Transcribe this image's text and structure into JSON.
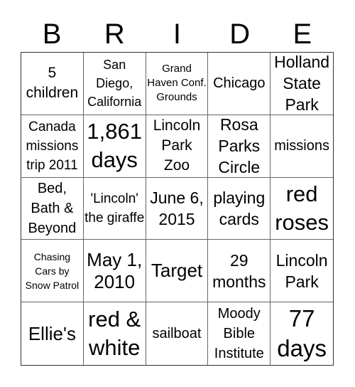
{
  "header": {
    "letters": [
      "B",
      "R",
      "I",
      "D",
      "E"
    ]
  },
  "cells": [
    "5 children",
    "San Diego, California",
    "Grand Haven Conf. Grounds",
    "Chicago",
    "Holland State Park",
    "Canada missions trip 2011",
    "1,861 days",
    "Lincoln Park Zoo",
    "Rosa Parks Circle",
    "missions",
    "Bed, Bath & Beyond",
    "'Lincoln' the giraffe",
    "June 6, 2015",
    "playing cards",
    "red roses",
    "Chasing Cars by Snow Patrol",
    "May 1, 2010",
    "Target",
    "29 months",
    "Lincoln Park",
    "Ellie's",
    "red & white",
    "sailboat",
    "Moody Bible Institute",
    "77 days"
  ]
}
